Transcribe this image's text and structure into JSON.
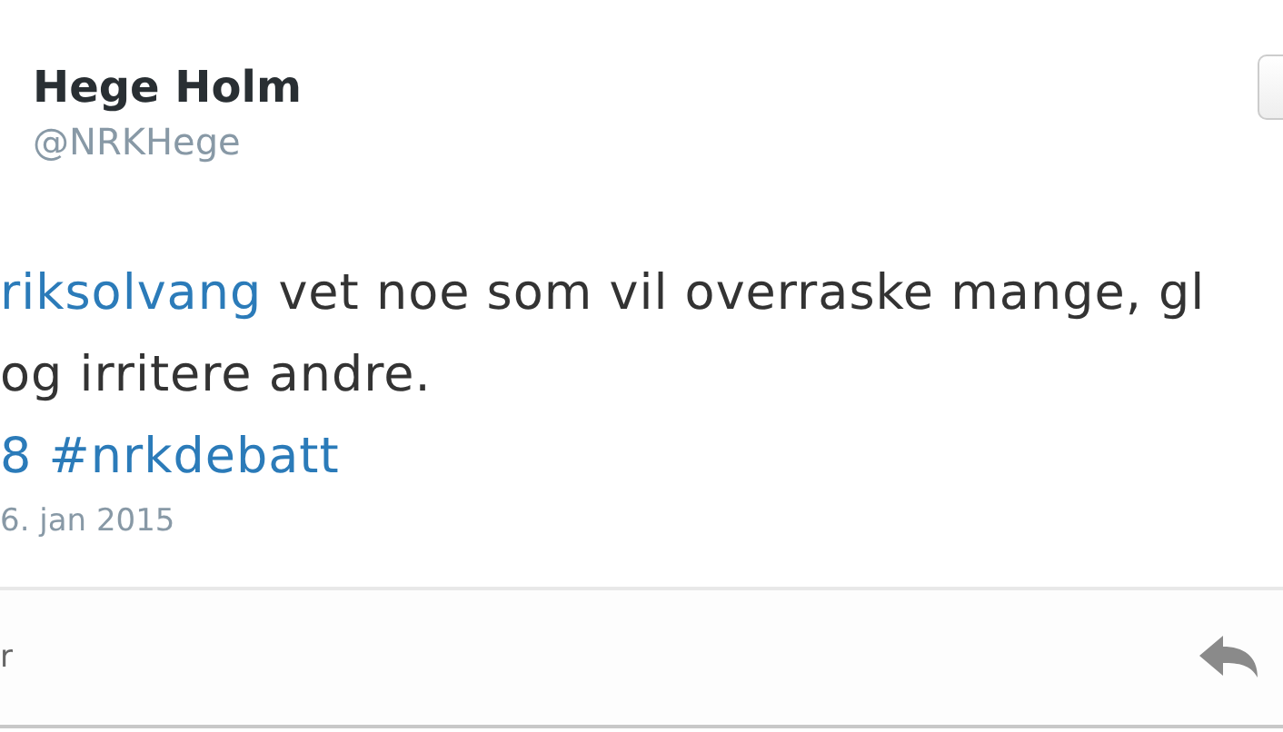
{
  "author": {
    "name": "Hege Holm",
    "handle": "@NRKHege"
  },
  "tweet": {
    "lines": [
      {
        "segments": [
          {
            "kind": "link",
            "text": "riksolvang"
          },
          {
            "kind": "text",
            "text": " vet noe som vil overraske mange, gl"
          }
        ]
      },
      {
        "segments": [
          {
            "kind": "text",
            "text": "og irritere andre."
          }
        ]
      },
      {
        "segments": [
          {
            "kind": "link",
            "text": "8 #nrkdebatt"
          }
        ]
      }
    ]
  },
  "date": "6. jan 2015",
  "footer": {
    "label": "r",
    "actions": [
      {
        "kind": "reply"
      }
    ]
  }
}
